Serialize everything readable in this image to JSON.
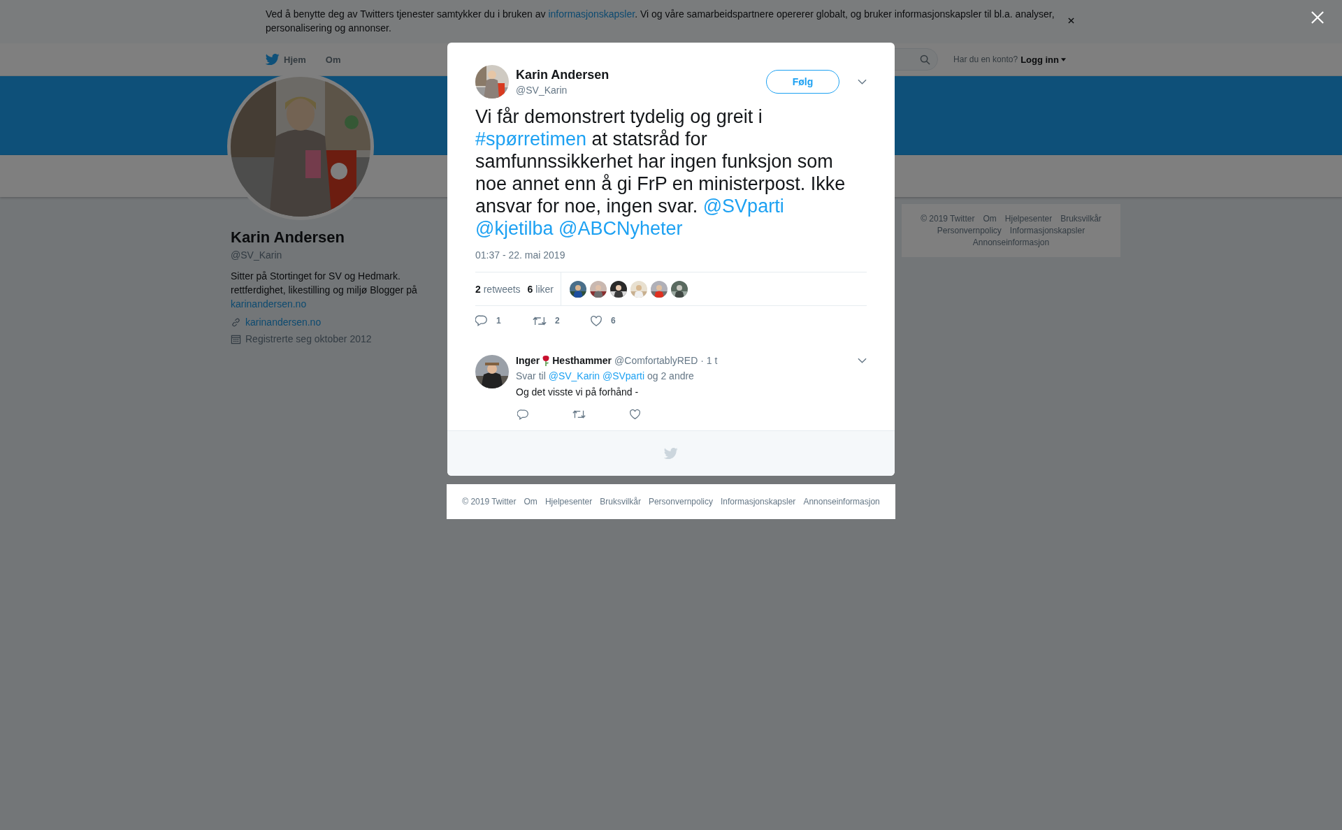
{
  "cookie_banner": {
    "text_before": "Ved å benytte deg av Twitters tjenester samtykker du i bruken av ",
    "link": "informasjonskapsler",
    "text_after": ". Vi og våre samarbeidspartnere opererer globalt, og bruker informasjonskapsler til bl.a. analyser, personalisering og annonser."
  },
  "nav": {
    "items": [
      {
        "label": "Hjem",
        "kind": "home"
      },
      {
        "label": "Om",
        "kind": "plain"
      }
    ],
    "login_prompt": "Har du en konto?",
    "login": "Logg inn"
  },
  "profile": {
    "name": "Karin Andersen",
    "handle": "@SV_Karin",
    "bio": "Sitter på Stortinget for SV og Hedmark. rettferdighet, likestilling og miljø Blogger på ",
    "bio_link": "karinandersen.no",
    "website": "karinandersen.no",
    "joined": "Registrerte seg oktober 2012"
  },
  "side_footer": {
    "links": [
      "© 2019 Twitter",
      "Om",
      "Hjelpesenter",
      "Bruksvilkår",
      "Personvernpolicy",
      "Informasjonskapsler",
      "Annonseinformasjon"
    ]
  },
  "modal": {
    "tweet": {
      "name": "Karin Andersen",
      "handle": "@SV_Karin",
      "follow": "Følg",
      "text": [
        {
          "kind": "text",
          "text": "Vi får demonstrert tydelig og greit i "
        },
        {
          "kind": "hashtag",
          "text": "#spørretimen"
        },
        {
          "kind": "text",
          "text": " at statsråd for samfunnssikkerhet har ingen funksjon som noe annet enn å gi FrP en ministerpost. Ikke ansvar for noe, ingen svar. "
        },
        {
          "kind": "mention",
          "text": "@SVparti"
        },
        {
          "kind": "mention",
          "text": "@kjetilba"
        },
        {
          "kind": "mention",
          "text": "@ABCNyheter"
        }
      ],
      "time": "01:37 - 22. mai 2019",
      "stats": [
        {
          "count": "2",
          "label": "retweets"
        },
        {
          "count": "6",
          "label": "liker"
        }
      ],
      "actions": [
        {
          "kind": "reply",
          "count": "1"
        },
        {
          "kind": "retweet",
          "count": "2"
        },
        {
          "kind": "like",
          "count": "6"
        }
      ]
    },
    "reply": {
      "name_parts": [
        "Inger",
        "Hesthammer"
      ],
      "handle": "@ComfortablyRED",
      "time": "· 1 t",
      "reply_to": "Svar til",
      "mentions": [
        "@SV_Karin",
        "@SVparti"
      ],
      "others": "og 2 andre",
      "text": "Og det visste vi på forhånd -",
      "actions": [
        {
          "kind": "reply"
        },
        {
          "kind": "retweet"
        },
        {
          "kind": "like"
        }
      ]
    }
  },
  "footer": {
    "links": [
      "© 2019 Twitter",
      "Om",
      "Hjelpesenter",
      "Bruksvilkår",
      "Personvernpolicy",
      "Informasjonskapsler",
      "Annonseinformasjon"
    ]
  }
}
